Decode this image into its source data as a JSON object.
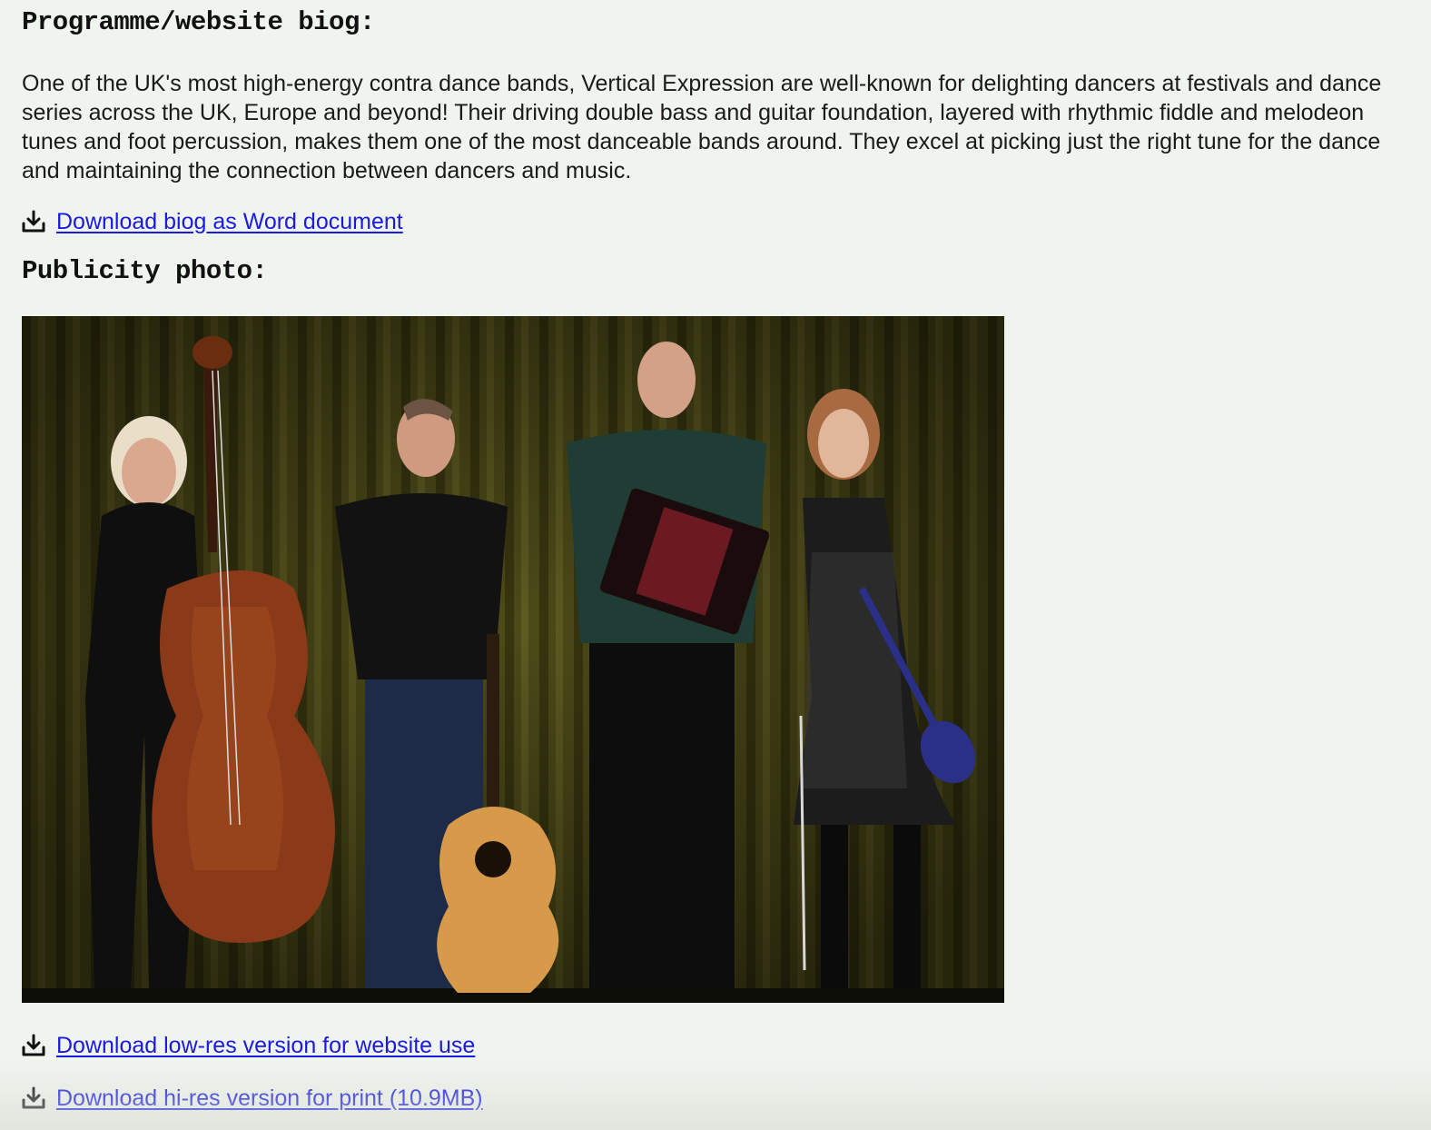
{
  "biog": {
    "heading": "Programme/website biog:",
    "text": "One of the UK's most high-energy contra dance bands, Vertical Expression are well-known for delighting dancers at festivals and dance series across the UK, Europe and beyond! Their driving double bass and guitar foundation, layered with rhythmic fiddle and melodeon tunes and foot percussion, makes them one of the most danceable bands around. They excel at picking just the right tune for the dance and maintaining the connection between dancers and music.",
    "download_label": "Download biog as Word document"
  },
  "photo": {
    "heading": "Publicity photo:",
    "download_low_label": "Download low-res version for website use",
    "download_hi_label": "Download hi-res version for print (10.9MB)"
  },
  "colors": {
    "background": "#f0f4ee",
    "link": "#1a1ae0",
    "curtain": "#4a4a1a"
  },
  "icons": {
    "download": "download-icon"
  }
}
